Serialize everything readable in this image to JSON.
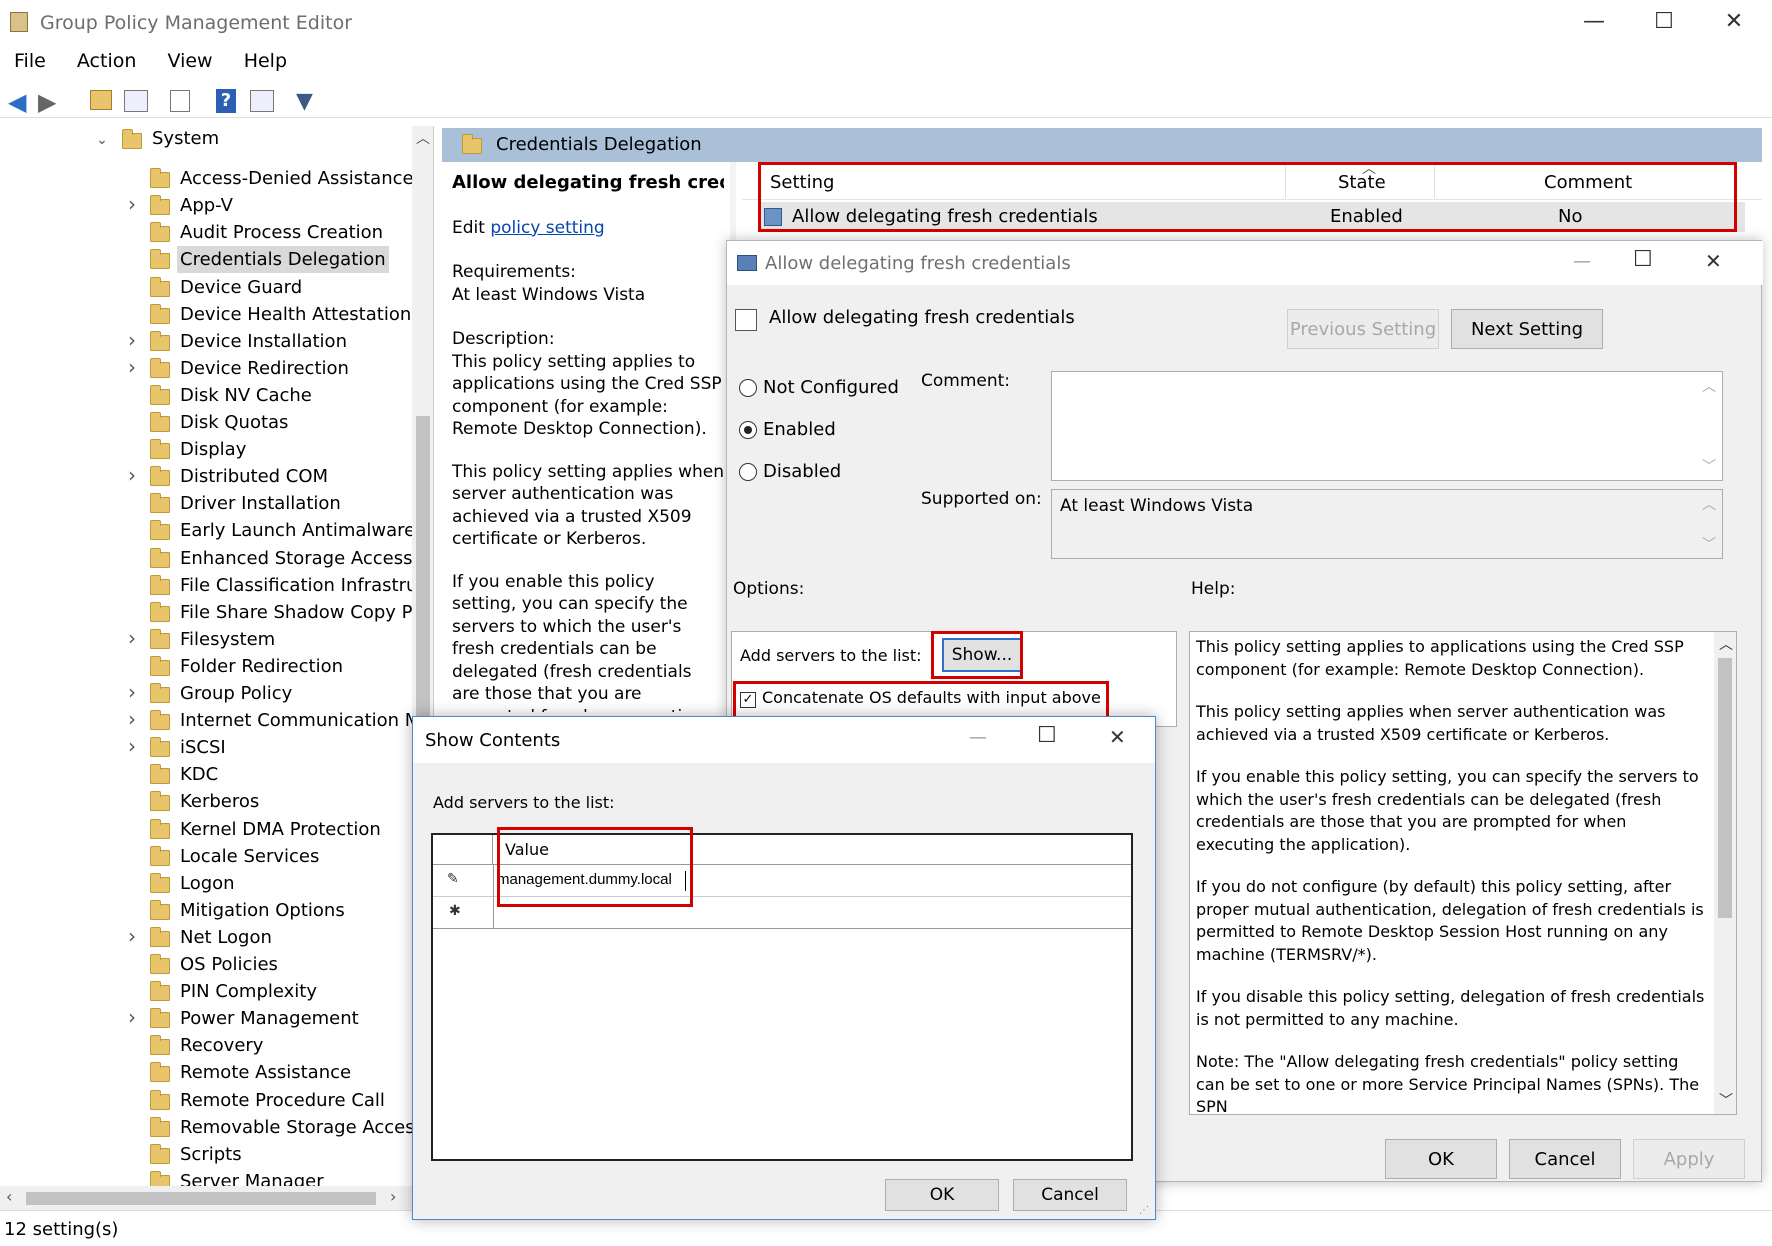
{
  "window": {
    "title": "Group Policy Management Editor"
  },
  "menu": [
    "File",
    "Action",
    "View",
    "Help"
  ],
  "tree": {
    "root": "System",
    "items": [
      {
        "label": "Access-Denied Assistance",
        "expandable": false
      },
      {
        "label": "App-V",
        "expandable": true
      },
      {
        "label": "Audit Process Creation",
        "expandable": false
      },
      {
        "label": "Credentials Delegation",
        "expandable": false,
        "selected": true
      },
      {
        "label": "Device Guard",
        "expandable": false
      },
      {
        "label": "Device Health Attestation Ser",
        "expandable": false
      },
      {
        "label": "Device Installation",
        "expandable": true
      },
      {
        "label": "Device Redirection",
        "expandable": true
      },
      {
        "label": "Disk NV Cache",
        "expandable": false
      },
      {
        "label": "Disk Quotas",
        "expandable": false
      },
      {
        "label": "Display",
        "expandable": false
      },
      {
        "label": "Distributed COM",
        "expandable": true
      },
      {
        "label": "Driver Installation",
        "expandable": false
      },
      {
        "label": "Early Launch Antimalware",
        "expandable": false
      },
      {
        "label": "Enhanced Storage Access",
        "expandable": false
      },
      {
        "label": "File Classification Infrastructu",
        "expandable": false
      },
      {
        "label": "File Share Shadow Copy Prov",
        "expandable": false
      },
      {
        "label": "Filesystem",
        "expandable": true
      },
      {
        "label": "Folder Redirection",
        "expandable": false
      },
      {
        "label": "Group Policy",
        "expandable": true
      },
      {
        "label": "Internet Communication Ma",
        "expandable": true
      },
      {
        "label": "iSCSI",
        "expandable": true
      },
      {
        "label": "KDC",
        "expandable": false
      },
      {
        "label": "Kerberos",
        "expandable": false
      },
      {
        "label": "Kernel DMA Protection",
        "expandable": false
      },
      {
        "label": "Locale Services",
        "expandable": false
      },
      {
        "label": "Logon",
        "expandable": false
      },
      {
        "label": "Mitigation Options",
        "expandable": false
      },
      {
        "label": "Net Logon",
        "expandable": true
      },
      {
        "label": "OS Policies",
        "expandable": false
      },
      {
        "label": "PIN Complexity",
        "expandable": false
      },
      {
        "label": "Power Management",
        "expandable": true
      },
      {
        "label": "Recovery",
        "expandable": false
      },
      {
        "label": "Remote Assistance",
        "expandable": false
      },
      {
        "label": "Remote Procedure Call",
        "expandable": false
      },
      {
        "label": "Removable Storage Access",
        "expandable": false
      },
      {
        "label": "Scripts",
        "expandable": false
      },
      {
        "label": "Server Manager",
        "expandable": false
      }
    ]
  },
  "status": "12 setting(s)",
  "details": {
    "header": "Credentials Delegation",
    "policy_title": "Allow delegating fresh credentials",
    "edit_prefix": "Edit",
    "edit_link": "policy setting",
    "requirements_label": "Requirements:",
    "requirements_value": "At least Windows Vista",
    "description_label": "Description:",
    "desc1": "This policy setting applies to applications using the Cred SSP component (for example: Remote Desktop Connection).",
    "desc2": "This policy setting applies when server authentication was achieved via a trusted X509 certificate or Kerberos.",
    "desc3": "If you enable this policy setting, you can specify the servers to which the user's fresh credentials can be delegated (fresh credentials are those that you are prompted for when executing the"
  },
  "list": {
    "col_setting": "Setting",
    "col_state": "State",
    "col_comment": "Comment",
    "row_setting": "Allow delegating fresh credentials",
    "row_state": "Enabled",
    "row_comment": "No"
  },
  "policy_dialog": {
    "title": "Allow delegating fresh credentials",
    "heading": "Allow delegating fresh credentials",
    "prev_button": "Previous Setting",
    "next_button": "Next Setting",
    "opt_not_configured": "Not Configured",
    "opt_enabled": "Enabled",
    "opt_disabled": "Disabled",
    "comment_label": "Comment:",
    "supported_label": "Supported on:",
    "supported_value": "At least Windows Vista",
    "options_label": "Options:",
    "help_label": "Help:",
    "add_servers_label": "Add servers to the list:",
    "show_button": "Show...",
    "concat_label": "Concatenate OS defaults with input above",
    "help1": "This policy setting applies to applications using the Cred SSP component (for example: Remote Desktop Connection).",
    "help2": "This policy setting applies when server authentication was achieved via a trusted X509 certificate or Kerberos.",
    "help3": "If you enable this policy setting, you can specify the servers to which the user's fresh credentials can be delegated (fresh credentials are those that you are prompted for when executing the application).",
    "help4": "If you do not configure (by default) this policy setting, after proper mutual authentication, delegation of fresh credentials is permitted to Remote Desktop Session Host running on any machine (TERMSRV/*).",
    "help5": "If you disable this policy setting, delegation of fresh credentials is not permitted to any machine.",
    "help6": "Note: The \"Allow delegating fresh credentials\" policy setting can be set to one or more Service Principal Names (SPNs). The SPN",
    "ok_button": "OK",
    "cancel_button": "Cancel",
    "apply_button": "Apply"
  },
  "show_dialog": {
    "title": "Show Contents",
    "label": "Add servers to the list:",
    "col_value": "Value",
    "row1_value": "management.dummy.local",
    "ok_button": "OK",
    "cancel_button": "Cancel"
  }
}
